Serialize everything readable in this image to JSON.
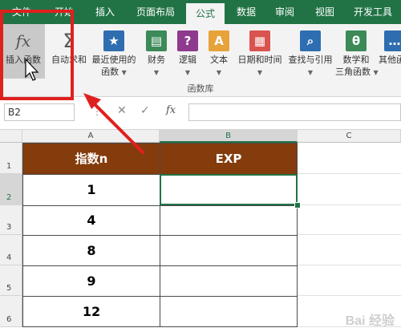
{
  "tabs": [
    {
      "label": "文件"
    },
    {
      "label": "开始"
    },
    {
      "label": "插入"
    },
    {
      "label": "页面布局"
    },
    {
      "label": "公式"
    },
    {
      "label": "数据"
    },
    {
      "label": "审阅"
    },
    {
      "label": "视图"
    },
    {
      "label": "开发工具"
    }
  ],
  "ribbon": {
    "buttons": [
      {
        "label": "插入函数",
        "label2": "",
        "icon": "fx-icon"
      },
      {
        "label": "自动求和",
        "label2": "",
        "icon": "sigma-icon"
      },
      {
        "label": "最近使用的",
        "label2": "函数",
        "icon": "star-book-icon"
      },
      {
        "label": "财务",
        "label2": "",
        "icon": "finance-book-icon"
      },
      {
        "label": "逻辑",
        "label2": "",
        "icon": "question-book-icon"
      },
      {
        "label": "文本",
        "label2": "",
        "icon": "text-book-icon"
      },
      {
        "label": "日期和时间",
        "label2": "",
        "icon": "calendar-icon"
      },
      {
        "label": "查找与引用",
        "label2": "",
        "icon": "magnifier-book-icon"
      },
      {
        "label": "数学和",
        "label2": "三角函数",
        "icon": "theta-book-icon"
      },
      {
        "label": "其他函",
        "label2": "",
        "icon": "more-functions-icon"
      }
    ],
    "group_label": "函数库",
    "fx_glyph": "fx",
    "sigma_glyph": "Σ"
  },
  "formula_bar": {
    "name_box": "B2",
    "fx_label": "fx",
    "formula": ""
  },
  "columns": [
    "A",
    "B",
    "C"
  ],
  "rows": [
    "1",
    "2",
    "3",
    "4",
    "5",
    "6"
  ],
  "table": {
    "headers": [
      "指数n",
      "EXP"
    ],
    "values": [
      "1",
      "4",
      "8",
      "9",
      "12"
    ]
  },
  "watermark": "Bai 经验",
  "colors": {
    "accent": "#217346",
    "header_fill": "#843c0c",
    "annotation": "#e0201e"
  }
}
